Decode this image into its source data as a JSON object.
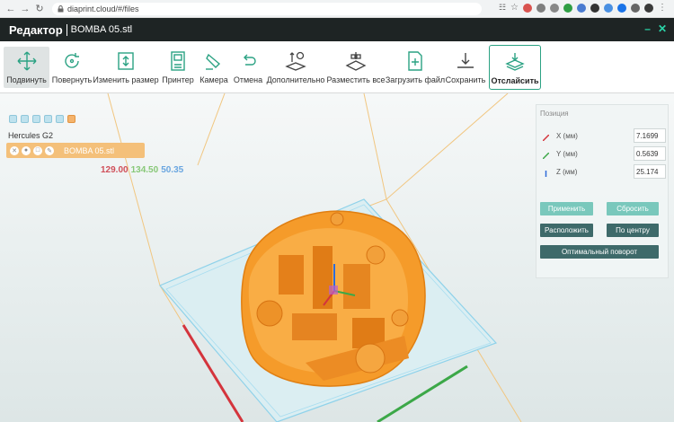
{
  "browser": {
    "url": "diaprint.cloud/#/files",
    "ext_colors": [
      "#d9534f",
      "#7f7f7f",
      "#2f9e44",
      "#4a7bd0",
      "#333333",
      "#4a90e2",
      "#1a73e8"
    ]
  },
  "app": {
    "title": "Редактор",
    "file_name": "BOMBA 05.stl",
    "accent_color": "#2ad4a8"
  },
  "toolbar": {
    "items": [
      {
        "label": "Подвинуть",
        "icon": "move-icon"
      },
      {
        "label": "Повернуть",
        "icon": "rotate-icon"
      },
      {
        "label": "Изменить размер",
        "icon": "resize-icon"
      },
      {
        "label": "Принтер",
        "icon": "printer-icon"
      },
      {
        "label": "Камера",
        "icon": "camera-icon"
      },
      {
        "label": "Отмена",
        "icon": "undo-icon"
      },
      {
        "label": "Дополнительно",
        "icon": "more-icon"
      },
      {
        "label": "Разместить все",
        "icon": "arrange-icon"
      },
      {
        "label": "Загрузить файл",
        "icon": "upload-icon"
      },
      {
        "label": "Сохранить",
        "icon": "save-icon"
      },
      {
        "label": "Отслайсить",
        "icon": "slice-icon"
      }
    ]
  },
  "viewport": {
    "printer_name": "Hercules G2",
    "object_name": "BOMBA 05.stl",
    "dims": {
      "x": "129.00",
      "y": "134.50",
      "z": "50.35"
    },
    "model_color": "#f59b2a"
  },
  "position_panel": {
    "title": "Позиция",
    "fields": [
      {
        "label": "X (мм)",
        "value": "7.1699"
      },
      {
        "label": "Y (мм)",
        "value": "0.5639"
      },
      {
        "label": "Z (мм)",
        "value": "25.174"
      }
    ],
    "buttons": {
      "apply": "Применить",
      "reset": "Сбросить",
      "arrange": "Расположить",
      "center": "По центру",
      "optimal": "Оптимальный поворот"
    }
  }
}
